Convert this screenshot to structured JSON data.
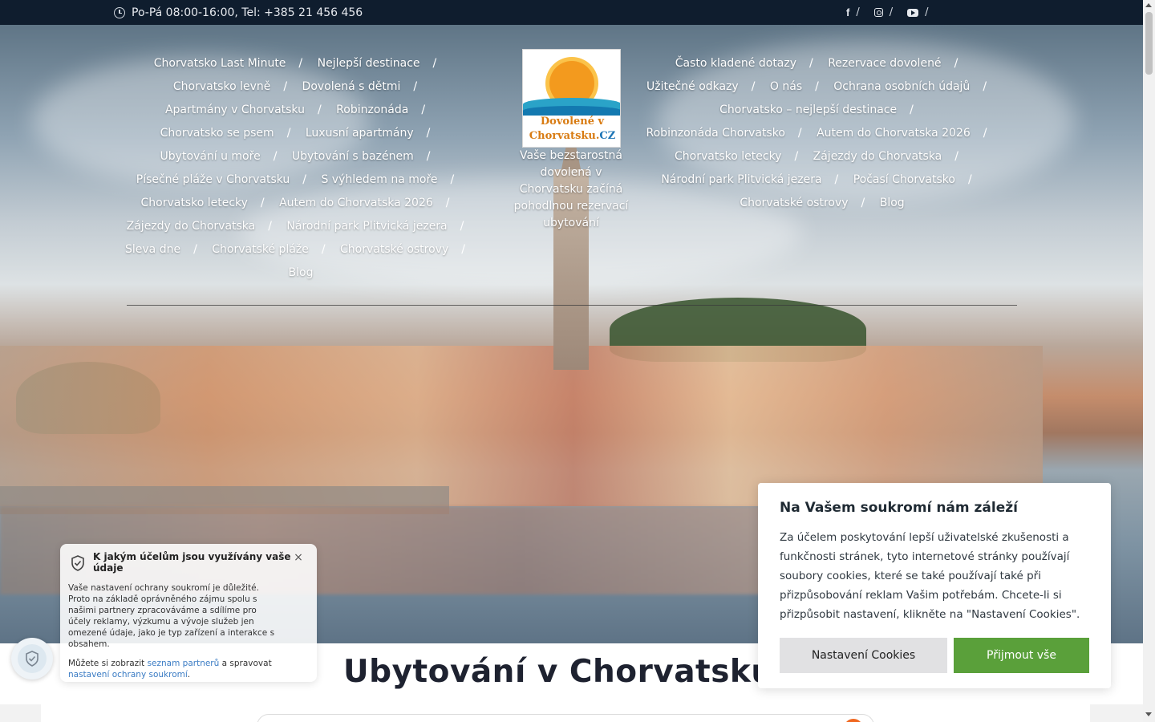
{
  "topbar": {
    "contact": "Po-Pá 08:00-16:00, Tel: +385 21 456 456",
    "social": [
      {
        "icon": "facebook-icon",
        "glyph": "f",
        "sep": "/"
      },
      {
        "icon": "instagram-icon",
        "sep": "/"
      },
      {
        "icon": "youtube-icon",
        "sep": "/"
      }
    ]
  },
  "nav_left": [
    "Chorvatsko Last Minute",
    "Nejlepší destinace",
    "Chorvatsko levně",
    "Dovolená s dětmi",
    "Apartmány v Chorvatsku",
    "Robinzonáda",
    "Chorvatsko se psem",
    "Luxusní apartmány",
    "Ubytování u moře",
    "Ubytování s bazénem",
    "Písečné pláže v Chorvatsku",
    "S výhledem na moře",
    "Chorvatsko letecky",
    "Autem do Chorvatska 2026",
    "Zájezdy do Chorvatska",
    "Národní park Plitvická jezera",
    "Sleva dne",
    "Chorvatské pláže",
    "Chorvatské ostrovy",
    "Blog"
  ],
  "nav_right": [
    "Často kladené dotazy",
    "Rezervace dovolené",
    "Užitečné odkazy",
    "O nás",
    "Ochrana osobních údajů",
    "Chorvatsko – nejlepší destinace",
    "Robinzonáda Chorvatsko",
    "Autem do Chorvatska 2026",
    "Chorvatsko letecky",
    "Zájezdy do Chorvatska",
    "Národní park Plitvická jezera",
    "Počasí Chorvatsko",
    "Chorvatské ostrovy",
    "Blog"
  ],
  "nav_separator": "/",
  "logo": {
    "line1": "Dovolené v",
    "line2": "Chorvatsku.",
    "line2_accent": "CZ"
  },
  "tagline": "Vaše bezstarostná dovolená v Chorvatsku začíná pohodlnou rezervací ubytování",
  "page_title": "Ubytování v Chorvatsku 20",
  "cookie": {
    "title": "Na Vašem soukromí nám záleží",
    "text": "Za účelem poskytování lepší uživatelské zkušenosti a funkčnosti stránek, tyto internetové stránky používají soubory cookies, které se také používají také při přizpůsobování reklam Vašim potřebám. Chcete-li si přizpůsobit nastavení, klikněte na \"Nastavení Cookies\".",
    "settings_label": "Nastavení Cookies",
    "accept_label": "Přijmout vše"
  },
  "privacy": {
    "title": "K jakým účelům jsou využívány vaše údaje",
    "body": "Vaše nastavení ochrany soukromí je důležité. Proto na základě oprávněného zájmu spolu s našimi partnery zpracováváme a sdílíme pro účely reklamy, výzkumu a vývoje služeb jen omezené údaje, jako je typ zařízení a interakce s obsahem.",
    "foot_prefix": "Můžete si zobrazit ",
    "link1": "seznam partnerů",
    "foot_mid": " a spravovat",
    "link2": "nastavení ochrany soukromí",
    "foot_end": ".",
    "close_glyph": "×"
  },
  "colors": {
    "topbar": "#0f1d2e",
    "accept": "#5aa03a",
    "settings": "#e1e1e3",
    "link": "#3b7cc4",
    "logo_orange": "#d87b12",
    "logo_blue": "#1b74b6"
  }
}
